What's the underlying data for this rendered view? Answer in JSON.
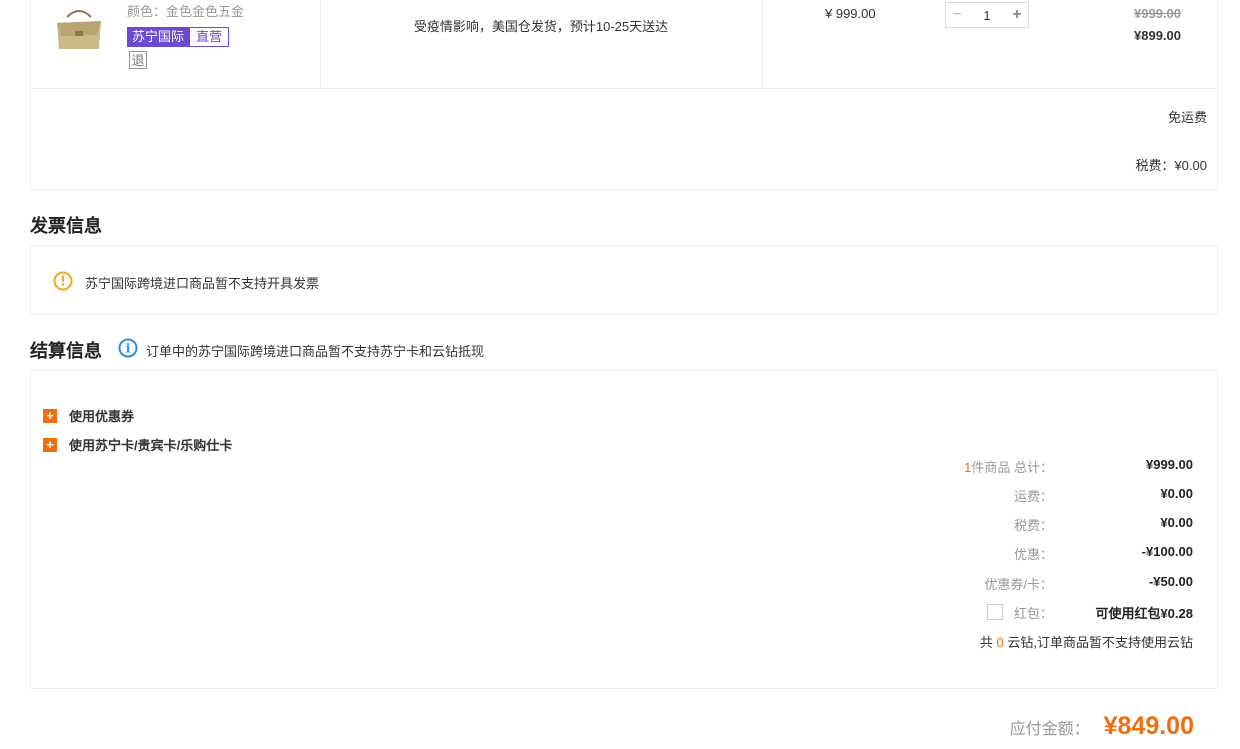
{
  "product": {
    "color_line": "颜色：金色金色五金",
    "badge_intl": "苏宁国际",
    "badge_direct": "直营",
    "return_icon_text": "退",
    "shipping_note": "受疫情影响，美国仓发货，预计10-25天送达",
    "unit_price": "¥ 999.00",
    "quantity": "1",
    "qty_minus": "−",
    "qty_plus": "+",
    "original_price": "¥999.00",
    "sale_price": "¥899.00",
    "shipping_fee": "免运费",
    "tax": "税费：¥0.00",
    "icons": {
      "thumbnail": "gold-handbag-image",
      "return": "return-icon"
    }
  },
  "invoice": {
    "title": "发票信息",
    "warning_text": "苏宁国际跨境进口商品暂不支持开具发票",
    "icon": "warning-icon",
    "icon_glyph": "!"
  },
  "settlement": {
    "title": "结算信息",
    "note": "订单中的苏宁国际跨境进口商品暂不支持苏宁卡和云钻抵现",
    "info_icon_glyph": "i",
    "options": [
      {
        "label": "使用优惠券",
        "icon_glyph": "+"
      },
      {
        "label": "使用苏宁卡/贵宾卡/乐购仕卡",
        "icon_glyph": "+"
      }
    ],
    "summary": {
      "item_count": "1",
      "item_count_suffix": "件商品 总计：",
      "subtotal": "¥999.00",
      "shipping_label": "运费：",
      "shipping": "¥0.00",
      "tax_label": "税费：",
      "tax": "¥0.00",
      "discount_label": "优惠：",
      "discount": "-¥100.00",
      "coupon_label": "优惠券/卡：",
      "coupon": "-¥50.00",
      "redpacket_label": "红包：",
      "redpacket": "可使用红包¥0.28",
      "cloud_prefix": "共",
      "cloud_count": "0",
      "cloud_suffix": "云钻,订单商品暂不支持使用云钻"
    }
  },
  "total": {
    "label": "应付金额：",
    "value": "¥849.00"
  },
  "colors": {
    "accent": "#f26d0d",
    "badge_purple": "#6a4bd2",
    "info_blue": "#2a8ce5",
    "warning_orange": "#f5a623"
  }
}
